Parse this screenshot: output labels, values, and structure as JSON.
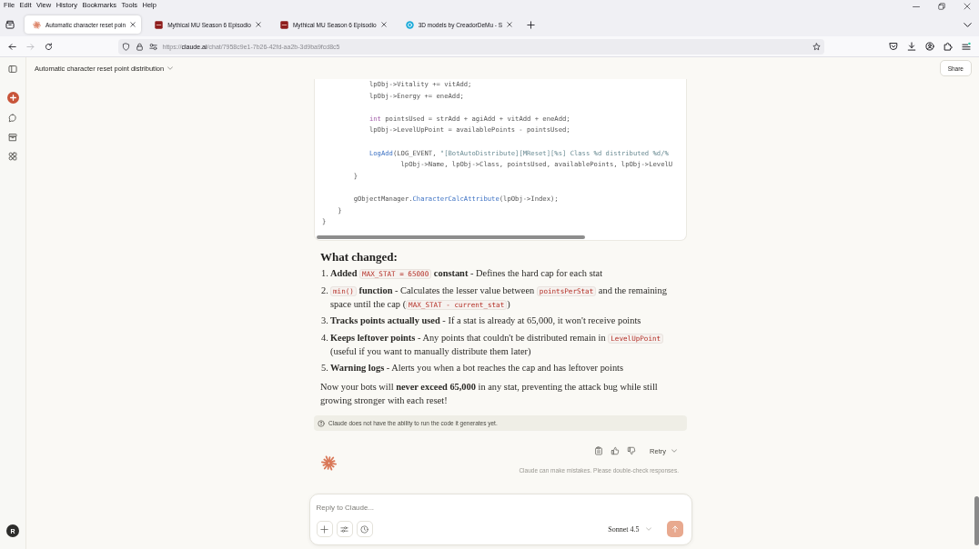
{
  "browser": {
    "menu": [
      "File",
      "Edit",
      "View",
      "History",
      "Bookmarks",
      "Tools",
      "Help"
    ],
    "tabs": [
      {
        "kind": "spark",
        "title": "Automatic character reset poin",
        "selected": true
      },
      {
        "kind": "tile",
        "title": "Mythical MU Season 6 Episodio",
        "selected": false
      },
      {
        "kind": "tile",
        "title": "Mythical MU Season 6 Episodio",
        "selected": false
      },
      {
        "kind": "disc",
        "title": "3D models by CreadorDeMu - S",
        "selected": false
      }
    ],
    "nav": {
      "back_disabled": false,
      "forward_disabled": true
    },
    "url": {
      "scheme": "https://",
      "host": "claude.ai",
      "path": "/chat/7958c9e1-7b26-42fd-aa2b-3d9ba9fcd8c5"
    }
  },
  "sidebar": {
    "user_initial": "R"
  },
  "header": {
    "title": "Automatic character reset point distribution",
    "share": "Share"
  },
  "code_block": {
    "lines": [
      {
        "kind": "code",
        "tokens": [
          {
            "kind": "plain",
            "text": "            lpObj->Vitality += vitAdd;"
          }
        ]
      },
      {
        "kind": "code",
        "tokens": [
          {
            "kind": "plain",
            "text": "            lpObj->Energy += eneAdd;"
          }
        ]
      },
      {
        "kind": "blank"
      },
      {
        "kind": "code",
        "tokens": [
          {
            "kind": "keyword",
            "text": "            int"
          },
          {
            "kind": "plain",
            "text": " pointsUsed = strAdd + agiAdd + vitAdd + eneAdd;"
          }
        ]
      },
      {
        "kind": "code",
        "tokens": [
          {
            "kind": "plain",
            "text": "            lpObj->LevelUpPoint = availablePoints - pointsUsed;"
          }
        ]
      },
      {
        "kind": "blank"
      },
      {
        "kind": "code",
        "tokens": [
          {
            "kind": "function",
            "text": "            LogAdd"
          },
          {
            "kind": "plain",
            "text": "(LOG_EVENT, "
          },
          {
            "kind": "string",
            "text": "\"[BotAutoDistribute][MReset][%s] Class %d distributed %d/%"
          }
        ]
      },
      {
        "kind": "code",
        "tokens": [
          {
            "kind": "plain",
            "text": "                    lpObj->Name, lpObj->Class, pointsUsed, availablePoints, lpObj->LevelU"
          }
        ]
      },
      {
        "kind": "code",
        "tokens": [
          {
            "kind": "plain",
            "text": "        }"
          }
        ]
      },
      {
        "kind": "blank"
      },
      {
        "kind": "code",
        "tokens": [
          {
            "kind": "plain",
            "text": "        gObjectManager."
          },
          {
            "kind": "function",
            "text": "CharacterCalcAttribute"
          },
          {
            "kind": "plain",
            "text": "(lpObj->Index);"
          }
        ]
      },
      {
        "kind": "code",
        "tokens": [
          {
            "kind": "plain",
            "text": "    }"
          }
        ]
      },
      {
        "kind": "code",
        "tokens": [
          {
            "kind": "plain",
            "text": "}"
          }
        ]
      }
    ]
  },
  "response": {
    "heading": "What changed:",
    "items": [
      {
        "number": "1.",
        "parts": [
          {
            "kind": "text",
            "text": "**Added** "
          },
          {
            "kind": "code",
            "text": "MAX_STAT = 65000"
          },
          {
            "kind": "text",
            "text": " **constant** - Defines the hard cap for each stat"
          }
        ]
      },
      {
        "number": "2.",
        "parts": [
          {
            "kind": "code",
            "text": "min()"
          },
          {
            "kind": "text",
            "text": " **function** - Calculates the lesser value between "
          },
          {
            "kind": "code",
            "text": "pointsPerStat"
          },
          {
            "kind": "text",
            "text": " and the remaining space until the cap ("
          },
          {
            "kind": "code",
            "text": "MAX_STAT - current_stat"
          },
          {
            "kind": "text",
            "text": ")"
          }
        ]
      },
      {
        "number": "3.",
        "parts": [
          {
            "kind": "text",
            "text": "**Tracks points actually used** - If a stat is already at 65,000, it won't receive points"
          }
        ]
      },
      {
        "number": "4.",
        "parts": [
          {
            "kind": "text",
            "text": "**Keeps leftover points** - Any points that couldn't be distributed remain in "
          },
          {
            "kind": "code",
            "text": "LevelUpPoint"
          },
          {
            "kind": "text",
            "text": " (useful if you want to manually distribute them later)"
          }
        ]
      },
      {
        "number": "5.",
        "parts": [
          {
            "kind": "text",
            "text": "**Warning logs** - Alerts you when a bot reaches the cap and has leftover points"
          }
        ]
      }
    ],
    "summary": "Now your bots will **never exceed 65,000** in any stat, preventing the attack bug while still growing stronger with each reset!"
  },
  "notice": "Claude does not have the ability to run the code it generates yet.",
  "actions": {
    "retry": "Retry",
    "disclaimer": "Claude can make mistakes. Please double-check responses."
  },
  "composer": {
    "placeholder": "Reply to Claude...",
    "model": "Sonnet 4.5",
    "send_disabled": true
  }
}
